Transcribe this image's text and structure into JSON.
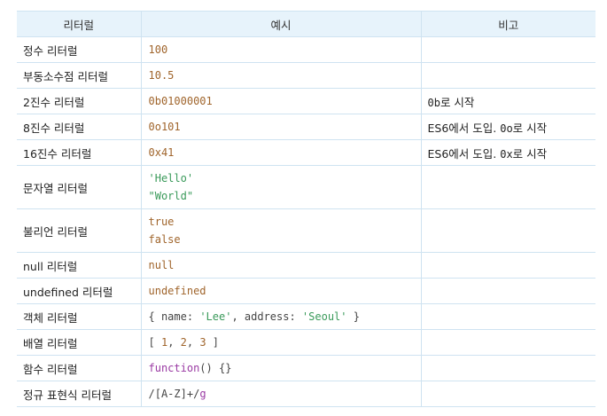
{
  "header": {
    "col1": "리터럴",
    "col2": "예시",
    "col3": "비고"
  },
  "rows": [
    {
      "name": "정수 리터럴",
      "example": "100",
      "note": ""
    },
    {
      "name": "부동소수점 리터럴",
      "example": "10.5",
      "note": ""
    },
    {
      "name": "2진수 리터럴",
      "example": "0b01000001",
      "note_code": "0b",
      "note_text": "로 시작"
    },
    {
      "name": "8진수 리터럴",
      "example": "0o101",
      "note_pre": "ES6에서 도입. ",
      "note_code": "0o",
      "note_text": "로 시작"
    },
    {
      "name": "16진수 리터럴",
      "example": "0x41",
      "note_pre": "ES6에서 도입. ",
      "note_code": "0x",
      "note_text": "로 시작"
    },
    {
      "name": "문자열 리터럴",
      "example_lines": [
        "'Hello'",
        "\"World\""
      ],
      "note": ""
    },
    {
      "name": "불리언 리터럴",
      "example_lines": [
        "true",
        "false"
      ],
      "note": ""
    },
    {
      "name": "null 리터럴",
      "example": "null",
      "note": ""
    },
    {
      "name": "undefined 리터럴",
      "example": "undefined",
      "note": ""
    },
    {
      "name": "객체 리터럴",
      "object": {
        "open": "{ ",
        "key1": "name: ",
        "val1": "'Lee'",
        "sep": ", ",
        "key2": "address: ",
        "val2": "'Seoul'",
        "close": " }"
      },
      "note": ""
    },
    {
      "name": "배열 리터럴",
      "array": {
        "open": "[ ",
        "v1": "1",
        "c1": ", ",
        "v2": "2",
        "c2": ", ",
        "v3": "3",
        "close": " ]"
      },
      "note": ""
    },
    {
      "name": "함수 리터럴",
      "func": {
        "kw": "function",
        "rest": "() {}"
      },
      "note": ""
    },
    {
      "name": "정규 표현식 리터럴",
      "regex": {
        "slash1": "/",
        "body": "[A-Z]+",
        "slash2": "/",
        "flag": "g"
      },
      "note": ""
    }
  ]
}
